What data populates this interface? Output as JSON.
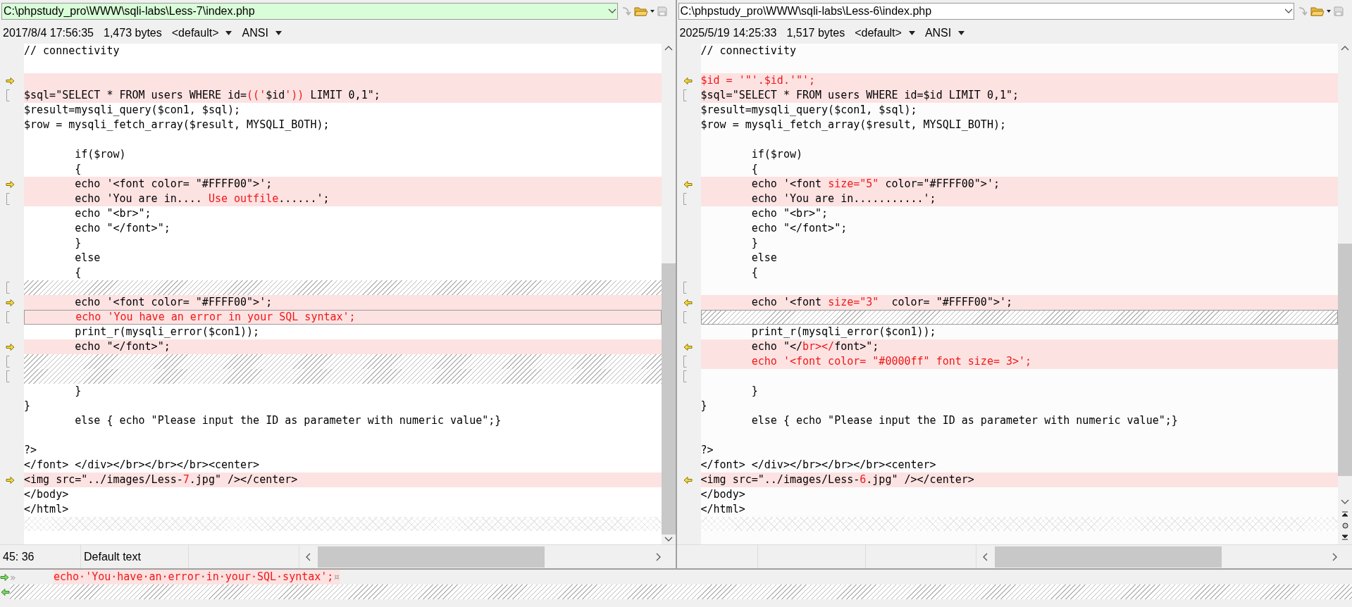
{
  "panes": [
    {
      "path": "C:\\phpstudy_pro\\WWW\\sqli-labs\\Less-7\\index.php",
      "active": true,
      "date": "2017/8/4 17:56:35",
      "size": "1,473 bytes",
      "codepage": "<default>",
      "encoding": "ANSI",
      "lines": [
        {
          "kind": "normal",
          "current": false,
          "text": "// connectivity"
        },
        {
          "kind": "normal",
          "current": false
        },
        {
          "kind": "diff",
          "current": false,
          "marker": {
            "kind": "arrow-right"
          }
        },
        {
          "kind": "diff",
          "current": false,
          "marker": {
            "kind": "bracket"
          },
          "parts": [
            {
              "text": "$sql=\"SELECT * FROM users WHERE id=",
              "changed": false
            },
            {
              "text": "(('",
              "changed": true
            },
            {
              "text": "$id",
              "changed": false
            },
            {
              "text": "'))",
              "changed": true
            },
            {
              "text": " LIMIT 0,1\";",
              "changed": false
            }
          ]
        },
        {
          "kind": "normal",
          "current": false,
          "text": "$result=mysqli_query($con1, $sql);"
        },
        {
          "kind": "normal",
          "current": false,
          "text": "$row = mysqli_fetch_array($result, MYSQLI_BOTH);"
        },
        {
          "kind": "normal",
          "current": false
        },
        {
          "kind": "normal",
          "current": false,
          "text": "        if($row)"
        },
        {
          "kind": "normal",
          "current": false,
          "text": "        {"
        },
        {
          "kind": "diff",
          "current": false,
          "marker": {
            "kind": "arrow-right"
          },
          "parts": [
            {
              "text": "        echo '<font color= \"#FFFF00\">';",
              "changed": false
            }
          ]
        },
        {
          "kind": "diff",
          "current": false,
          "marker": {
            "kind": "bracket"
          },
          "parts": [
            {
              "text": "        echo 'You are in.... ",
              "changed": false
            },
            {
              "text": "Use outfile",
              "changed": true
            },
            {
              "text": "......';",
              "changed": false
            }
          ]
        },
        {
          "kind": "normal",
          "current": false,
          "text": "        echo \"<br>\";"
        },
        {
          "kind": "normal",
          "current": false,
          "text": "        echo \"</font>\";"
        },
        {
          "kind": "normal",
          "current": false,
          "text": "        }"
        },
        {
          "kind": "normal",
          "current": false,
          "text": "        else"
        },
        {
          "kind": "normal",
          "current": false,
          "text": "        {"
        },
        {
          "kind": "hatch",
          "current": false,
          "marker": {
            "kind": "bracket"
          }
        },
        {
          "kind": "diff",
          "current": false,
          "marker": {
            "kind": "arrow-right"
          },
          "parts": [
            {
              "text": "        echo '<font color= \"#FFFF00\">';",
              "changed": false
            }
          ]
        },
        {
          "kind": "diff",
          "current": true,
          "marker": {
            "kind": "bracket"
          },
          "parts": [
            {
              "text": "        echo 'You have an error in your SQL syntax';",
              "changed": true
            }
          ]
        },
        {
          "kind": "normal",
          "current": false,
          "text": "        print_r(mysqli_error($con1));"
        },
        {
          "kind": "diff",
          "current": false,
          "marker": {
            "kind": "arrow-right"
          },
          "parts": [
            {
              "text": "        echo \"</font>\";",
              "changed": false
            }
          ]
        },
        {
          "kind": "hatch",
          "current": false,
          "marker": {
            "kind": "bracket"
          }
        },
        {
          "kind": "hatch",
          "current": false,
          "marker": {
            "kind": "bracket"
          }
        },
        {
          "kind": "normal",
          "current": false,
          "text": "        }"
        },
        {
          "kind": "normal",
          "current": false,
          "text": "}"
        },
        {
          "kind": "normal",
          "current": false,
          "text": "        else { echo \"Please input the ID as parameter with numeric value\";}"
        },
        {
          "kind": "normal",
          "current": false
        },
        {
          "kind": "normal",
          "current": false,
          "text": "?>"
        },
        {
          "kind": "normal",
          "current": false,
          "text": "</font> </div></br></br></br><center>"
        },
        {
          "kind": "diff",
          "current": false,
          "marker": {
            "kind": "arrow-right"
          },
          "parts": [
            {
              "text": "<img src=\"../images/Less-",
              "changed": false
            },
            {
              "text": "7",
              "changed": true
            },
            {
              "text": ".jpg\" /></center>",
              "changed": false
            }
          ]
        },
        {
          "kind": "normal",
          "current": false,
          "text": "</body>"
        },
        {
          "kind": "normal",
          "current": false,
          "text": "</html>"
        }
      ],
      "status": [
        "45: 36",
        "Default text"
      ]
    },
    {
      "path": "C:\\phpstudy_pro\\WWW\\sqli-labs\\Less-6\\index.php",
      "active": false,
      "date": "2025/5/19 14:25:33",
      "size": "1,517 bytes",
      "codepage": "<default>",
      "encoding": "ANSI",
      "lines": [
        {
          "kind": "normal",
          "current": false,
          "text": "// connectivity"
        },
        {
          "kind": "normal",
          "current": false
        },
        {
          "kind": "diff",
          "current": false,
          "marker": {
            "kind": "arrow-left"
          },
          "parts": [
            {
              "text": "$id = '\"'.$id.'\"';",
              "changed": true
            }
          ]
        },
        {
          "kind": "diff",
          "current": false,
          "marker": {
            "kind": "bracket"
          },
          "parts": [
            {
              "text": "$sql=\"SELECT * FROM users WHERE id=$id LIMIT 0,1\";",
              "changed": false
            }
          ]
        },
        {
          "kind": "normal",
          "current": false,
          "text": "$result=mysqli_query($con1, $sql);"
        },
        {
          "kind": "normal",
          "current": false,
          "text": "$row = mysqli_fetch_array($result, MYSQLI_BOTH);"
        },
        {
          "kind": "normal",
          "current": false
        },
        {
          "kind": "normal",
          "current": false,
          "text": "        if($row)"
        },
        {
          "kind": "normal",
          "current": false,
          "text": "        {"
        },
        {
          "kind": "diff",
          "current": false,
          "marker": {
            "kind": "arrow-left"
          },
          "parts": [
            {
              "text": "        echo '<font ",
              "changed": false
            },
            {
              "text": "size=\"5\"",
              "changed": true
            },
            {
              "text": " color=\"#FFFF00\">';",
              "changed": false
            }
          ]
        },
        {
          "kind": "diff",
          "current": false,
          "marker": {
            "kind": "bracket"
          },
          "parts": [
            {
              "text": "        echo 'You are in...........';",
              "changed": false
            }
          ]
        },
        {
          "kind": "normal",
          "current": false,
          "text": "        echo \"<br>\";"
        },
        {
          "kind": "normal",
          "current": false,
          "text": "        echo \"</font>\";"
        },
        {
          "kind": "normal",
          "current": false,
          "text": "        }"
        },
        {
          "kind": "normal",
          "current": false,
          "text": "        else"
        },
        {
          "kind": "normal",
          "current": false,
          "text": "        {"
        },
        {
          "kind": "normal",
          "current": false,
          "marker": {
            "kind": "bracket"
          }
        },
        {
          "kind": "diff",
          "current": false,
          "marker": {
            "kind": "arrow-left"
          },
          "parts": [
            {
              "text": "        echo '<font ",
              "changed": false
            },
            {
              "text": "size=\"3\"",
              "changed": true
            },
            {
              "text": "  color= \"#FFFF00\">';",
              "changed": false
            }
          ]
        },
        {
          "kind": "hatch",
          "current": true,
          "marker": {
            "kind": "bracket"
          }
        },
        {
          "kind": "normal",
          "current": false,
          "text": "        print_r(mysqli_error($con1));"
        },
        {
          "kind": "diff",
          "current": false,
          "marker": {
            "kind": "arrow-left"
          },
          "parts": [
            {
              "text": "        echo \"</",
              "changed": false
            },
            {
              "text": "br></",
              "changed": true
            },
            {
              "text": "font>\";",
              "changed": false
            }
          ]
        },
        {
          "kind": "diff",
          "current": false,
          "marker": {
            "kind": "bracket"
          },
          "parts": [
            {
              "text": "        echo '<font color= \"#0000ff\" font size= 3>';",
              "changed": true
            }
          ]
        },
        {
          "kind": "normal",
          "current": false,
          "marker": {
            "kind": "bracket"
          }
        },
        {
          "kind": "normal",
          "current": false,
          "text": "        }"
        },
        {
          "kind": "normal",
          "current": false,
          "text": "}"
        },
        {
          "kind": "normal",
          "current": false,
          "text": "        else { echo \"Please input the ID as parameter with numeric value\";}"
        },
        {
          "kind": "normal",
          "current": false
        },
        {
          "kind": "normal",
          "current": false,
          "text": "?>"
        },
        {
          "kind": "normal",
          "current": false,
          "text": "</font> </div></br></br></br><center>"
        },
        {
          "kind": "diff",
          "current": false,
          "marker": {
            "kind": "arrow-left"
          },
          "parts": [
            {
              "text": "<img src=\"../images/Less-",
              "changed": false
            },
            {
              "text": "6",
              "changed": true
            },
            {
              "text": ".jpg\" /></center>",
              "changed": false
            }
          ]
        },
        {
          "kind": "normal",
          "current": false,
          "text": "</body>"
        },
        {
          "kind": "normal",
          "current": false,
          "text": "</html>"
        }
      ]
    }
  ],
  "detail": [
    {
      "kind": "diff",
      "marker": {
        "kind": "arrow-right"
      },
      "tab": "»",
      "text": "echo·'You·have·an·error·in·your·SQL·syntax';",
      "eol": "¤"
    },
    {
      "kind": "hatch",
      "marker": {
        "kind": "arrow-left"
      }
    }
  ]
}
